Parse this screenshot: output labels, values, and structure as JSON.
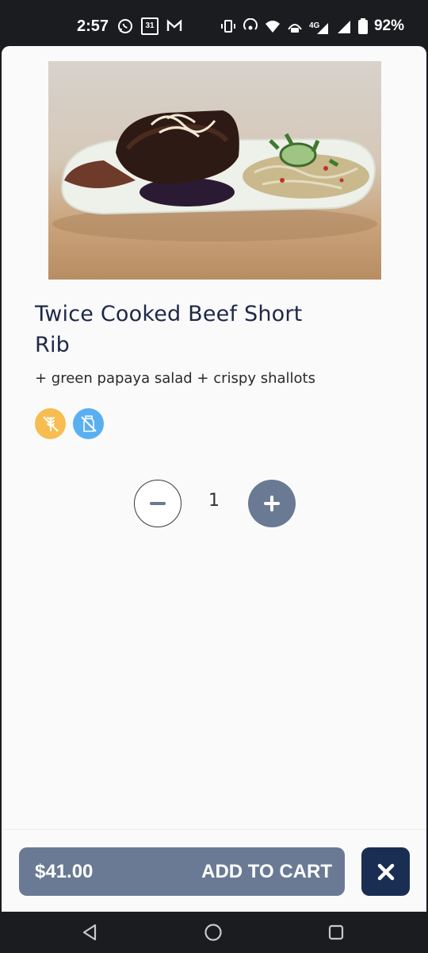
{
  "status_bar": {
    "time": "2:57",
    "calendar_day": "31",
    "battery": "92%",
    "icons": [
      "whatsapp-icon",
      "calendar-icon",
      "gmail-icon",
      "vibrate-icon",
      "hotspot-icon",
      "wifi-icon",
      "volte-icon",
      "signal-4g-icon",
      "signal-icon",
      "battery-icon"
    ]
  },
  "item": {
    "title": "Twice Cooked Beef Short Rib",
    "description": "+ green papaya salad + crispy shallots",
    "badges": [
      {
        "name": "gluten-free-icon",
        "color": "#f7bd50"
      },
      {
        "name": "dairy-free-icon",
        "color": "#5aaff0"
      }
    ]
  },
  "quantity": {
    "value": "1"
  },
  "cart": {
    "price": "$41.00",
    "label": "ADD TO CART",
    "accent": "#6a7a94",
    "close_color": "#1a2d52"
  },
  "nav": [
    "back-icon",
    "home-icon",
    "recents-icon"
  ]
}
